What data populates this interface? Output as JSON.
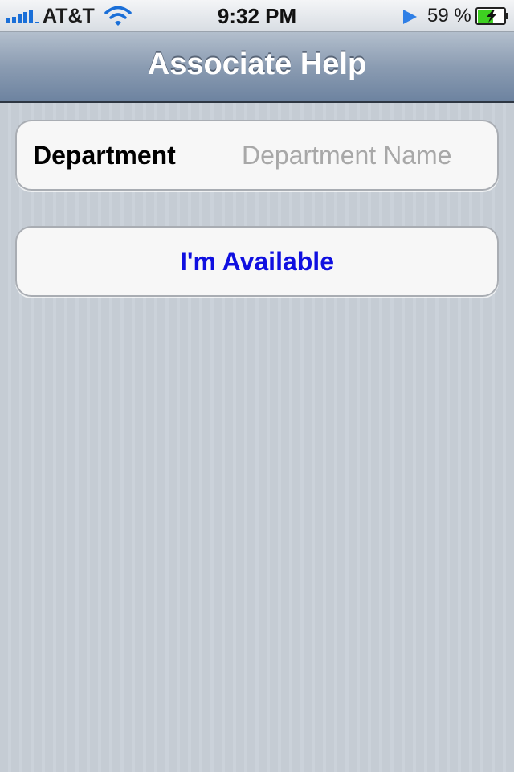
{
  "status_bar": {
    "carrier": "AT&T",
    "time": "9:32 PM",
    "battery_percent": "59 %",
    "icons": [
      "signal-bars-icon",
      "wifi-icon",
      "location-arrow-icon",
      "battery-charging-icon"
    ],
    "battery_level": 0.59
  },
  "nav_bar": {
    "title": "Associate Help"
  },
  "form": {
    "department": {
      "label": "Department",
      "value": "",
      "placeholder": "Department Name"
    },
    "available_button": {
      "label": "I'm Available",
      "color": "#0f0fe0"
    }
  },
  "colors": {
    "nav_bar": "#7b8fa9",
    "background": "#c5ccd4",
    "cell_background": "#f7f7f7",
    "location_arrow": "#2f7fe6",
    "battery_fill": "#3ed021"
  }
}
